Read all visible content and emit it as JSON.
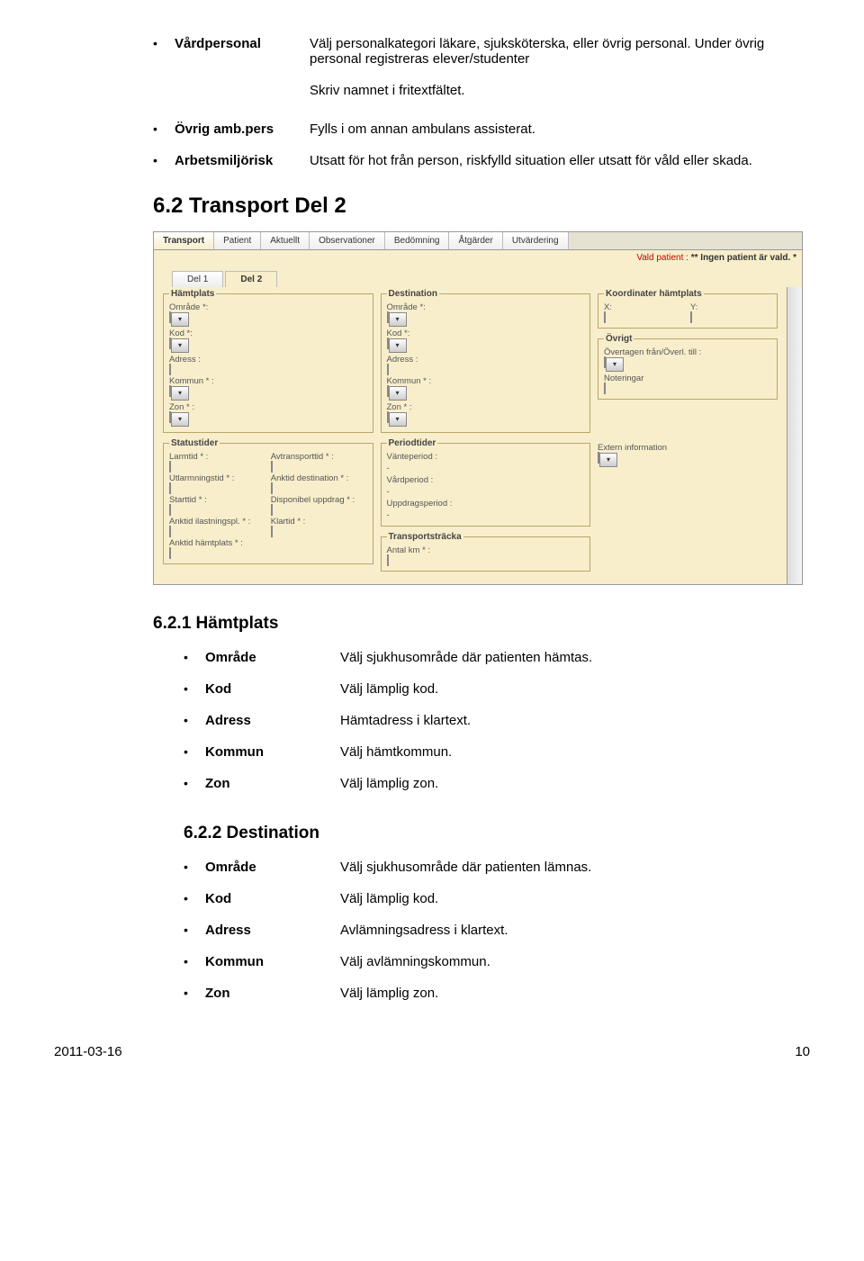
{
  "s1": {
    "items": [
      {
        "label": "Vårdpersonal",
        "desc": "Välj personalkategori läkare, sjuksköterska, eller övrig personal. Under övrig personal registreras elever/studenter"
      }
    ],
    "note": "Skriv namnet i fritextfältet."
  },
  "s2": {
    "items": [
      {
        "label": "Övrig amb.pers",
        "desc": "Fylls i om annan ambulans assisterat."
      },
      {
        "label": "Arbetsmiljörisk",
        "desc": "Utsatt för hot från person, riskfylld situation eller utsatt för våld eller skada."
      }
    ]
  },
  "heading": "6.2 Transport Del 2",
  "screenshot": {
    "tabs": [
      "Transport",
      "Patient",
      "Aktuellt",
      "Observationer",
      "Bedömning",
      "Åtgärder",
      "Utvärdering"
    ],
    "subtabs": [
      "Del 1",
      "Del 2"
    ],
    "status_label": "Vald patient :",
    "status_value": "** Ingen patient är vald. *",
    "hamtplats": {
      "legend": "Hämtplats",
      "omrade": "Område *:",
      "kod": "Kod *:",
      "adress": "Adress :",
      "kommun": "Kommun * :",
      "zon": "Zon * :"
    },
    "destination": {
      "legend": "Destination",
      "omrade": "Område *:",
      "kod": "Kod *:",
      "adress": "Adress :",
      "kommun": "Kommun * :",
      "zon": "Zon * :"
    },
    "koord": {
      "legend": "Koordinater hämtplats",
      "x": "X:",
      "y": "Y:"
    },
    "ovrigt": {
      "legend": "Övrigt",
      "over": "Övertagen från/Överl. till :",
      "noter": "Noteringar"
    },
    "statustider": {
      "legend": "Statustider",
      "larmtid": "Larmtid * :",
      "avtransport": "Avtransporttid * :",
      "utlarm": "Utlarmningstid * :",
      "anktiddest": "Anktid destination * :",
      "starttid": "Starttid * :",
      "disponibel": "Disponibel uppdrag * :",
      "anktidl": "Anktid ilastningspl. * :",
      "klartid": "Klartid * :",
      "anktidh": "Anktid hämtplats * :"
    },
    "periodtider": {
      "legend": "Periodtider",
      "vant": "Vänteperiod :",
      "vard": "Vårdperiod :",
      "uppd": "Uppdragsperiod :",
      "dash": "-"
    },
    "transportstracka": {
      "legend": "Transportsträcka",
      "antal": "Antal km * :"
    },
    "extern": "Extern information"
  },
  "sub1": {
    "title": "6.2.1 Hämtplats",
    "items": [
      {
        "label": "Område",
        "desc": "Välj sjukhusområde där patienten hämtas."
      },
      {
        "label": "Kod",
        "desc": "Välj lämplig kod."
      },
      {
        "label": "Adress",
        "desc": "Hämtadress i klartext."
      },
      {
        "label": "Kommun",
        "desc": "Välj hämtkommun."
      },
      {
        "label": "Zon",
        "desc": "Välj lämplig zon."
      }
    ]
  },
  "sub2": {
    "title": "6.2.2 Destination",
    "items": [
      {
        "label": "Område",
        "desc": "Välj sjukhusområde där patienten lämnas."
      },
      {
        "label": "Kod",
        "desc": "Välj lämplig kod."
      },
      {
        "label": "Adress",
        "desc": "Avlämningsadress i klartext."
      },
      {
        "label": "Kommun",
        "desc": "Välj avlämningskommun."
      },
      {
        "label": "Zon",
        "desc": "Välj lämplig zon."
      }
    ]
  },
  "footer": {
    "date": "2011-03-16",
    "page": "10"
  }
}
